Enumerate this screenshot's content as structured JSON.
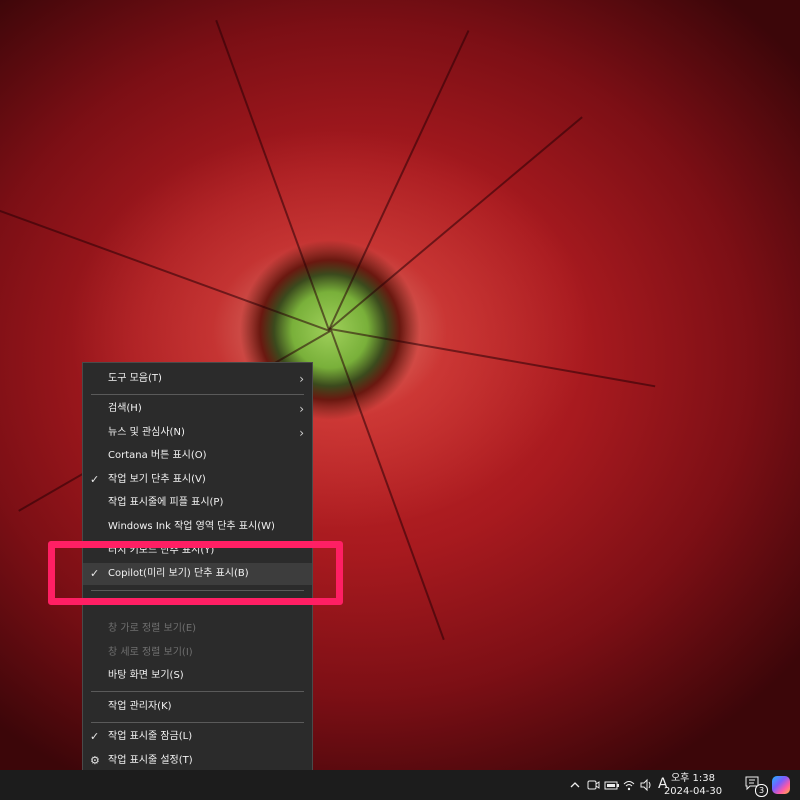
{
  "context_menu": {
    "items": [
      {
        "label": "도구 모음(T)",
        "checked": false,
        "submenu": true,
        "disabled": false
      },
      {
        "label": "검색(H)",
        "checked": false,
        "submenu": true,
        "disabled": false
      },
      {
        "label": "뉴스 및 관심사(N)",
        "checked": false,
        "submenu": true,
        "disabled": false
      },
      {
        "label": "Cortana 버튼 표시(O)",
        "checked": false,
        "submenu": false,
        "disabled": false
      },
      {
        "label": "작업 보기 단추 표시(V)",
        "checked": true,
        "submenu": false,
        "disabled": false
      },
      {
        "label": "작업 표시줄에 피플 표시(P)",
        "checked": false,
        "submenu": false,
        "disabled": false
      },
      {
        "label": "Windows Ink 작업 영역 단추 표시(W)",
        "checked": false,
        "submenu": false,
        "disabled": false
      },
      {
        "label": "터치 키보드 단추 표시(Y)",
        "checked": false,
        "submenu": false,
        "disabled": false
      },
      {
        "label": "Copilot(미리 보기) 단추 표시(B)",
        "checked": true,
        "submenu": false,
        "disabled": false
      },
      {
        "label": "창 가로 정렬 보기(E)",
        "checked": false,
        "submenu": false,
        "disabled": true
      },
      {
        "label": "창 세로 정렬 보기(I)",
        "checked": false,
        "submenu": false,
        "disabled": true
      },
      {
        "label": "바탕 화면 보기(S)",
        "checked": false,
        "submenu": false,
        "disabled": false
      },
      {
        "label": "작업 관리자(K)",
        "checked": false,
        "submenu": false,
        "disabled": false
      },
      {
        "label": "작업 표시줄 잠금(L)",
        "checked": true,
        "submenu": false,
        "disabled": false
      },
      {
        "label": "작업 표시줄 설정(T)",
        "checked": false,
        "submenu": false,
        "disabled": false
      }
    ],
    "check_glyph": "✓",
    "arrow_glyph": "›",
    "gear_glyph": "⚙"
  },
  "taskbar": {
    "clock_time": "오후 1:38",
    "clock_date": "2024-04-30",
    "ime_indicator": "A",
    "notification_count": "3",
    "tray_icons": [
      "chevron-up-icon",
      "meet-now-icon",
      "battery-icon",
      "network-icon",
      "volume-icon"
    ]
  },
  "highlight_color": "#ff1f64"
}
